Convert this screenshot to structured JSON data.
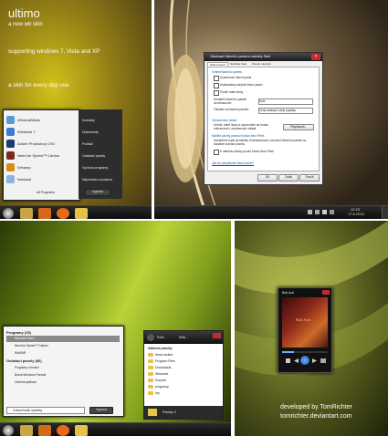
{
  "panel1": {
    "title": "ultimo",
    "subtitle": "a new wb skin",
    "support": "supporting windows 7, Vista and XP",
    "tagline": "a skin for every day use",
    "menu_items": [
      "WindowBlinds",
      "Windows 7",
      "Adobe Photoshop CS5",
      "Need for Speed™ Carbon",
      "Winamp",
      "Notepad"
    ],
    "right_items": [
      "Kontakty",
      "Dokumenty",
      "Počítač",
      "Ovládací panely",
      "Výchozí programy",
      "Nápověda a podpora"
    ],
    "all_programs": "All Programs",
    "shutdown": "Vypnout"
  },
  "panel2": {
    "dialog_title": "Vlastnosti Hlavního panelu a nabídky Start",
    "tabs": [
      "Hlavní panel",
      "Nabídka Start",
      "Panely nástrojů"
    ],
    "section1": "Vzhled hlavního panelu",
    "checks": [
      "Uzamknout hlavní panel",
      "Automaticky skrývat hlavní panel",
      "Použít malé ikony"
    ],
    "position_label": "Umístění hlavního panelu na obrazovce:",
    "position_value": "Dole",
    "buttons_label": "Tlačítka na hlavním panelu:",
    "buttons_value": "Vždy seskupit, skrýt popisky",
    "notif_section": "Oznamovací oblast",
    "notif_text": "Určete, které ikony a upozornění se budou zobrazovat v oznamovací oblasti.",
    "customize": "Přizpůsobit...",
    "peek_section": "Náhled plochy pomocí funkce Aero Peek",
    "peek_text": "Umístěním myši na tlačítko Zobrazit plochu na konci hlavního panelu se dočasně zobrazí plocha.",
    "peek_check": "K náhledu plochy použít funkci Aero Peek",
    "help_link": "Jak lze přizpůsobit hlavní panel?",
    "ok": "OK",
    "cancel": "Zrušit",
    "apply": "Použít",
    "clock_time": "12:25",
    "clock_date": "17.6.2010"
  },
  "panel3": {
    "programs_header": "Programy (15)",
    "programs": [
      "Microsoft Word",
      "Need for Speed™ Carbon",
      "WinRAR"
    ],
    "cp_header": "Ovládací panely (56)",
    "cp_items": [
      "Programy a funkce",
      "Brána Windows Firewall",
      "Odebrat aplikace"
    ],
    "search_value": "Zobrazit další výsledky",
    "shutdown": "Vypnout",
    "explorer_tabs": [
      "Počít...",
      "Wink..."
    ],
    "explorer_section": "Oblíbené položky",
    "explorer_items": [
      "Nová složka",
      "Program Files",
      "Downloads",
      "Windows",
      "Sounds",
      "programy",
      "hry"
    ],
    "explorer_status": "Položky: 9"
  },
  "panel4": {
    "track": "Bob Acri",
    "album_text": "Bob Acri",
    "credit1": "developed by TomRichter",
    "credit2": "tomrichter.deviantart.com"
  }
}
